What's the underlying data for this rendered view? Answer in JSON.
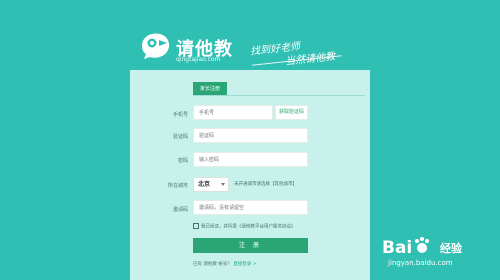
{
  "header": {
    "brand_name": "请他教",
    "domain": "qingtajiao.com",
    "slogan_line1": "找到好老师",
    "slogan_line2": "当然请他教"
  },
  "form": {
    "tab_label": "家长注册",
    "phone": {
      "label": "手机号",
      "placeholder": "手机号",
      "sms_button": "获取验证码"
    },
    "code": {
      "label": "验证码",
      "placeholder": "验证码"
    },
    "password": {
      "label": "密码",
      "placeholder": "输入密码"
    },
    "city": {
      "label": "所在城市",
      "selected": "北京",
      "note": "未开通城市请选择【其他城市】"
    },
    "invite": {
      "label": "邀请码",
      "placeholder": "邀请码，没有请留空"
    },
    "agreement_text": "我已阅读，并同意《请他教平台用户服务协议》",
    "submit_label": "注 册",
    "login_prompt": "已有 请他教 帐号？",
    "login_link": "直接登录 >"
  },
  "watermark": {
    "text_bai": "Bai",
    "text_jingyan": "经验",
    "url": "jingyan.baidu.com"
  }
}
